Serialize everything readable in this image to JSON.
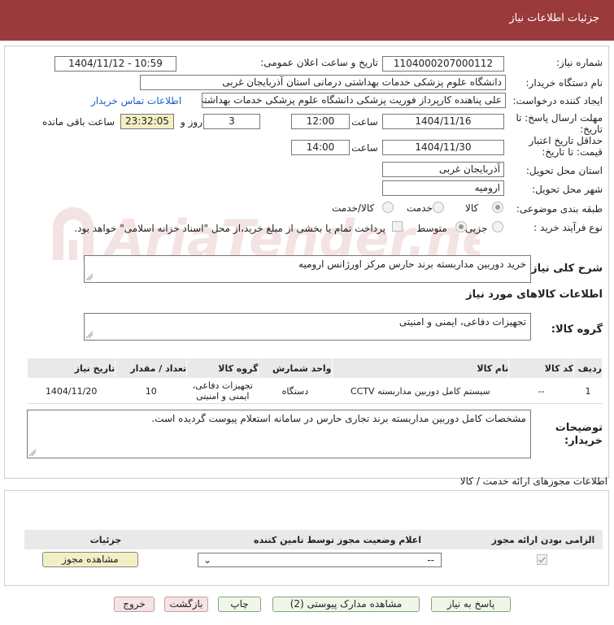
{
  "header": {
    "title": "جزئیات اطلاعات نیاز"
  },
  "form": {
    "need_number_label": "شماره نیاز:",
    "need_number": "1104000207000112",
    "announce_label": "تاریخ و ساعت اعلان عمومی:",
    "announce_value": "1404/11/12 - 10:59",
    "buyer_org_label": "نام دستگاه خریدار:",
    "buyer_org": "دانشگاه علوم پزشکی خدمات بهداشتی درمانی استان آذربایجان غربی",
    "requester_label": "ایجاد کننده درخواست:",
    "requester": "علی پناهنده کارپرداز فوریت پزشکی دانشگاه علوم پزشکی خدمات بهداشتی درمانی",
    "contact_link": "اطلاعات تماس خریدار",
    "deadline_label": "مهلت ارسال پاسخ: تا تاریخ:",
    "deadline_date": "1404/11/16",
    "time_label": "ساعت",
    "deadline_time": "12:00",
    "days_value": "3",
    "days_label": "روز و",
    "remaining_time": "23:32:05",
    "remaining_label": "ساعت باقی مانده",
    "validity_label": "حداقل تاریخ اعتبار قیمت: تا تاریخ:",
    "validity_date": "1404/11/30",
    "validity_time": "14:00",
    "province_label": "استان محل تحویل:",
    "province": "آذربایجان غربی",
    "city_label": "شهر محل تحویل:",
    "city": "ارومیه",
    "category_label": "طبقه بندی موضوعی:",
    "category_options": [
      "کالا",
      "خدمت",
      "کالا/خدمت"
    ],
    "purchase_type_label": "نوع فرآیند خرید :",
    "purchase_options": [
      "جزیی",
      "متوسط"
    ],
    "payment_note": "پرداخت تمام یا بخشی از مبلغ خرید،از محل \"اسناد خزانه اسلامی\" خواهد بود.",
    "summary_label": "شرح کلی نیاز:",
    "summary_value": "خرید دوربین مداربسته برند حارس مرکز اورژانس ارومیه",
    "goods_info_title": "اطلاعات کالاهای مورد نیاز",
    "goods_group_label": "گروه کالا:",
    "goods_group_value": "تجهیزات دفاعی، ایمنی و امنیتی"
  },
  "goods_table": {
    "headers": [
      "ردیف",
      "کد کالا",
      "نام کالا",
      "واحد شمارش",
      "گروه کالا",
      "تعداد / مقدار",
      "تاریخ نیاز"
    ],
    "rows": [
      [
        "1",
        "--",
        "سیستم کامل دوربین مداربسته CCTV",
        "دستگاه",
        "تجهیزات دفاعی، ایمنی و امنیتی",
        "10",
        "1404/11/20"
      ]
    ]
  },
  "buyer_notes": {
    "label": "توضیحات خریدار:",
    "value": "مشخصات کامل دوربین مداربسته برند تجاری حارس در سامانه استعلام پیوست گردیده است."
  },
  "permits": {
    "title": "اطلاعات مجوزهای ارائه خدمت / کالا",
    "headers": [
      "الزامی بودن ارائه مجوز",
      "اعلام وضعیت مجوز توسط تامین کننده",
      "جزئیات"
    ],
    "select_value": "--",
    "view_button": "مشاهده مجوز"
  },
  "footer_buttons": {
    "reply": "پاسخ به نیاز",
    "attachments": "مشاهده مدارک پیوستی (2)",
    "print": "چاپ",
    "back": "بازگشت",
    "exit": "خروج"
  },
  "watermark": "AriaTender.neT"
}
